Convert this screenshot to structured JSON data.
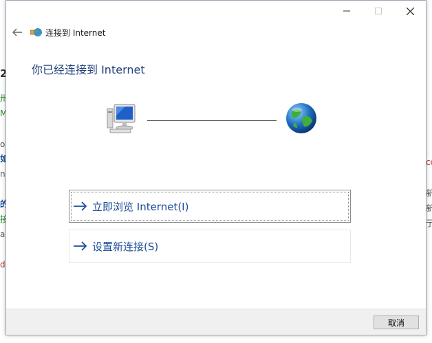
{
  "background": {
    "left_fragments": [
      "2",
      "卅",
      "M",
      "o",
      "如",
      "n",
      "的",
      "接",
      "ad",
      "d"
    ],
    "right_fragments": [
      "co",
      "新",
      "新",
      "亍"
    ]
  },
  "window": {
    "title": "连接到 Internet",
    "controls": [
      "minimize-icon",
      "maximize-icon",
      "close-icon"
    ]
  },
  "main": {
    "heading": "你已经连接到 Internet",
    "options": [
      {
        "label": "立即浏览 Internet(I)",
        "icon": "arrow-right-icon"
      },
      {
        "label": "设置新连接(S)",
        "icon": "arrow-right-icon"
      }
    ]
  },
  "footer": {
    "cancel_label": "取消"
  },
  "colors": {
    "link": "#1a4b96",
    "heading": "#1f3f7a",
    "footer_bg": "#f0f0f0"
  }
}
